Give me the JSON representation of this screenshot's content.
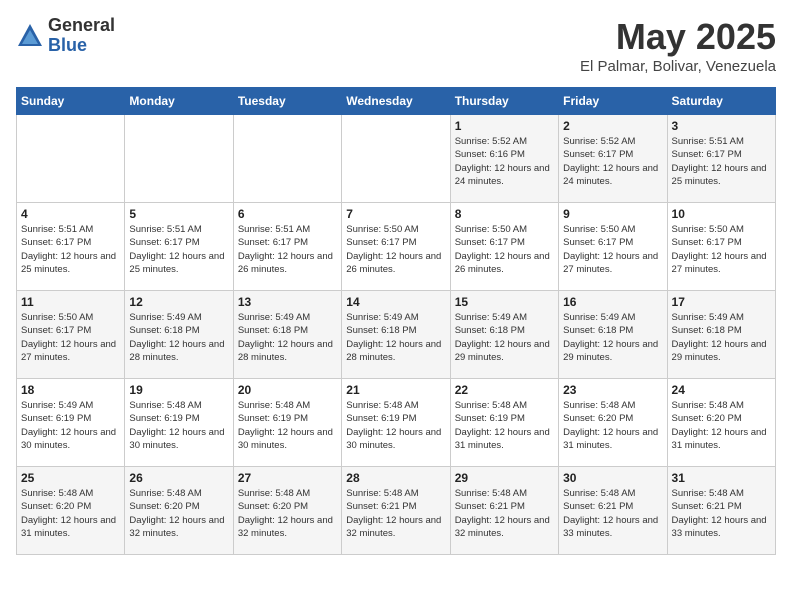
{
  "header": {
    "logo_line1": "General",
    "logo_line2": "Blue",
    "month": "May 2025",
    "location": "El Palmar, Bolivar, Venezuela"
  },
  "weekdays": [
    "Sunday",
    "Monday",
    "Tuesday",
    "Wednesday",
    "Thursday",
    "Friday",
    "Saturday"
  ],
  "weeks": [
    [
      {
        "num": "",
        "detail": ""
      },
      {
        "num": "",
        "detail": ""
      },
      {
        "num": "",
        "detail": ""
      },
      {
        "num": "",
        "detail": ""
      },
      {
        "num": "1",
        "detail": "Sunrise: 5:52 AM\nSunset: 6:16 PM\nDaylight: 12 hours and 24 minutes."
      },
      {
        "num": "2",
        "detail": "Sunrise: 5:52 AM\nSunset: 6:17 PM\nDaylight: 12 hours and 24 minutes."
      },
      {
        "num": "3",
        "detail": "Sunrise: 5:51 AM\nSunset: 6:17 PM\nDaylight: 12 hours and 25 minutes."
      }
    ],
    [
      {
        "num": "4",
        "detail": "Sunrise: 5:51 AM\nSunset: 6:17 PM\nDaylight: 12 hours and 25 minutes."
      },
      {
        "num": "5",
        "detail": "Sunrise: 5:51 AM\nSunset: 6:17 PM\nDaylight: 12 hours and 25 minutes."
      },
      {
        "num": "6",
        "detail": "Sunrise: 5:51 AM\nSunset: 6:17 PM\nDaylight: 12 hours and 26 minutes."
      },
      {
        "num": "7",
        "detail": "Sunrise: 5:50 AM\nSunset: 6:17 PM\nDaylight: 12 hours and 26 minutes."
      },
      {
        "num": "8",
        "detail": "Sunrise: 5:50 AM\nSunset: 6:17 PM\nDaylight: 12 hours and 26 minutes."
      },
      {
        "num": "9",
        "detail": "Sunrise: 5:50 AM\nSunset: 6:17 PM\nDaylight: 12 hours and 27 minutes."
      },
      {
        "num": "10",
        "detail": "Sunrise: 5:50 AM\nSunset: 6:17 PM\nDaylight: 12 hours and 27 minutes."
      }
    ],
    [
      {
        "num": "11",
        "detail": "Sunrise: 5:50 AM\nSunset: 6:17 PM\nDaylight: 12 hours and 27 minutes."
      },
      {
        "num": "12",
        "detail": "Sunrise: 5:49 AM\nSunset: 6:18 PM\nDaylight: 12 hours and 28 minutes."
      },
      {
        "num": "13",
        "detail": "Sunrise: 5:49 AM\nSunset: 6:18 PM\nDaylight: 12 hours and 28 minutes."
      },
      {
        "num": "14",
        "detail": "Sunrise: 5:49 AM\nSunset: 6:18 PM\nDaylight: 12 hours and 28 minutes."
      },
      {
        "num": "15",
        "detail": "Sunrise: 5:49 AM\nSunset: 6:18 PM\nDaylight: 12 hours and 29 minutes."
      },
      {
        "num": "16",
        "detail": "Sunrise: 5:49 AM\nSunset: 6:18 PM\nDaylight: 12 hours and 29 minutes."
      },
      {
        "num": "17",
        "detail": "Sunrise: 5:49 AM\nSunset: 6:18 PM\nDaylight: 12 hours and 29 minutes."
      }
    ],
    [
      {
        "num": "18",
        "detail": "Sunrise: 5:49 AM\nSunset: 6:19 PM\nDaylight: 12 hours and 30 minutes."
      },
      {
        "num": "19",
        "detail": "Sunrise: 5:48 AM\nSunset: 6:19 PM\nDaylight: 12 hours and 30 minutes."
      },
      {
        "num": "20",
        "detail": "Sunrise: 5:48 AM\nSunset: 6:19 PM\nDaylight: 12 hours and 30 minutes."
      },
      {
        "num": "21",
        "detail": "Sunrise: 5:48 AM\nSunset: 6:19 PM\nDaylight: 12 hours and 30 minutes."
      },
      {
        "num": "22",
        "detail": "Sunrise: 5:48 AM\nSunset: 6:19 PM\nDaylight: 12 hours and 31 minutes."
      },
      {
        "num": "23",
        "detail": "Sunrise: 5:48 AM\nSunset: 6:20 PM\nDaylight: 12 hours and 31 minutes."
      },
      {
        "num": "24",
        "detail": "Sunrise: 5:48 AM\nSunset: 6:20 PM\nDaylight: 12 hours and 31 minutes."
      }
    ],
    [
      {
        "num": "25",
        "detail": "Sunrise: 5:48 AM\nSunset: 6:20 PM\nDaylight: 12 hours and 31 minutes."
      },
      {
        "num": "26",
        "detail": "Sunrise: 5:48 AM\nSunset: 6:20 PM\nDaylight: 12 hours and 32 minutes."
      },
      {
        "num": "27",
        "detail": "Sunrise: 5:48 AM\nSunset: 6:20 PM\nDaylight: 12 hours and 32 minutes."
      },
      {
        "num": "28",
        "detail": "Sunrise: 5:48 AM\nSunset: 6:21 PM\nDaylight: 12 hours and 32 minutes."
      },
      {
        "num": "29",
        "detail": "Sunrise: 5:48 AM\nSunset: 6:21 PM\nDaylight: 12 hours and 32 minutes."
      },
      {
        "num": "30",
        "detail": "Sunrise: 5:48 AM\nSunset: 6:21 PM\nDaylight: 12 hours and 33 minutes."
      },
      {
        "num": "31",
        "detail": "Sunrise: 5:48 AM\nSunset: 6:21 PM\nDaylight: 12 hours and 33 minutes."
      }
    ]
  ]
}
